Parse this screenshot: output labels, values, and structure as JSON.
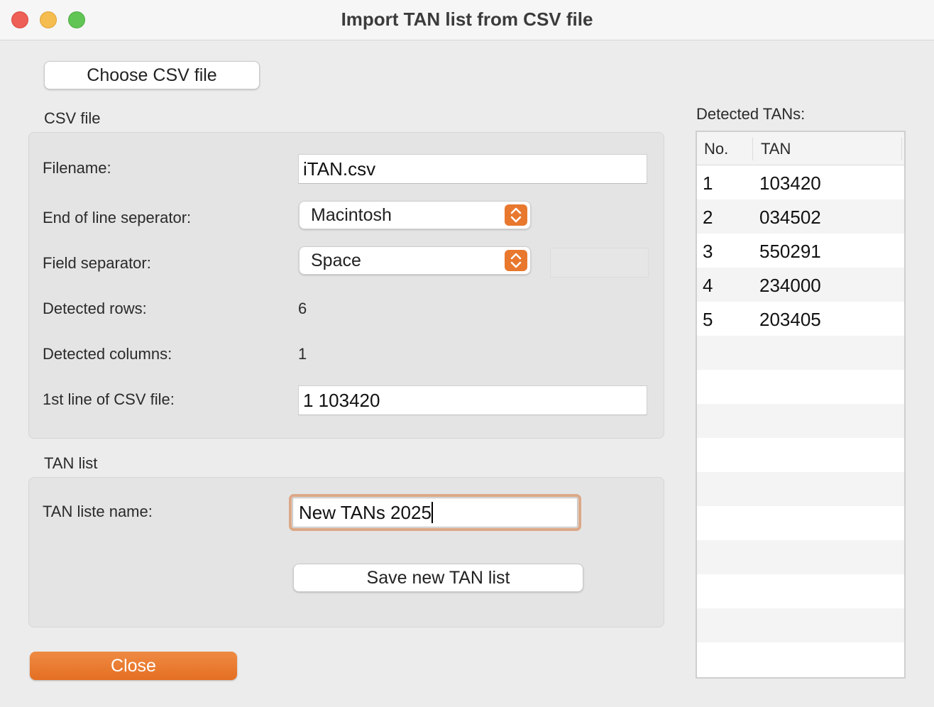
{
  "window": {
    "title": "Import TAN list from CSV file"
  },
  "toolbar": {
    "choose_label": "Choose CSV file"
  },
  "csv_section": {
    "label": "CSV file",
    "filename_label": "Filename:",
    "filename_value": "iTAN.csv",
    "eol_label": "End of line seperator:",
    "eol_value": "Macintosh",
    "field_sep_label": "Field separator:",
    "field_sep_value": "Space",
    "rows_label": "Detected rows:",
    "rows_value": "6",
    "cols_label": "Detected columns:",
    "cols_value": "1",
    "first_line_label": "1st line of CSV file:",
    "first_line_value": "1 103420"
  },
  "tan_section": {
    "label": "TAN list",
    "name_label": "TAN liste name:",
    "name_value": "New TANs 2025",
    "save_label": "Save new TAN list"
  },
  "footer": {
    "close_label": "Close"
  },
  "detected": {
    "label": "Detected TANs:",
    "columns": [
      "No.",
      "TAN"
    ],
    "rows": [
      {
        "no": "1",
        "tan": "103420"
      },
      {
        "no": "2",
        "tan": "034502"
      },
      {
        "no": "3",
        "tan": "550291"
      },
      {
        "no": "4",
        "tan": "234000"
      },
      {
        "no": "5",
        "tan": "203405"
      }
    ]
  },
  "colors": {
    "accent": "#e8782e",
    "focus_ring": "#dba887"
  }
}
